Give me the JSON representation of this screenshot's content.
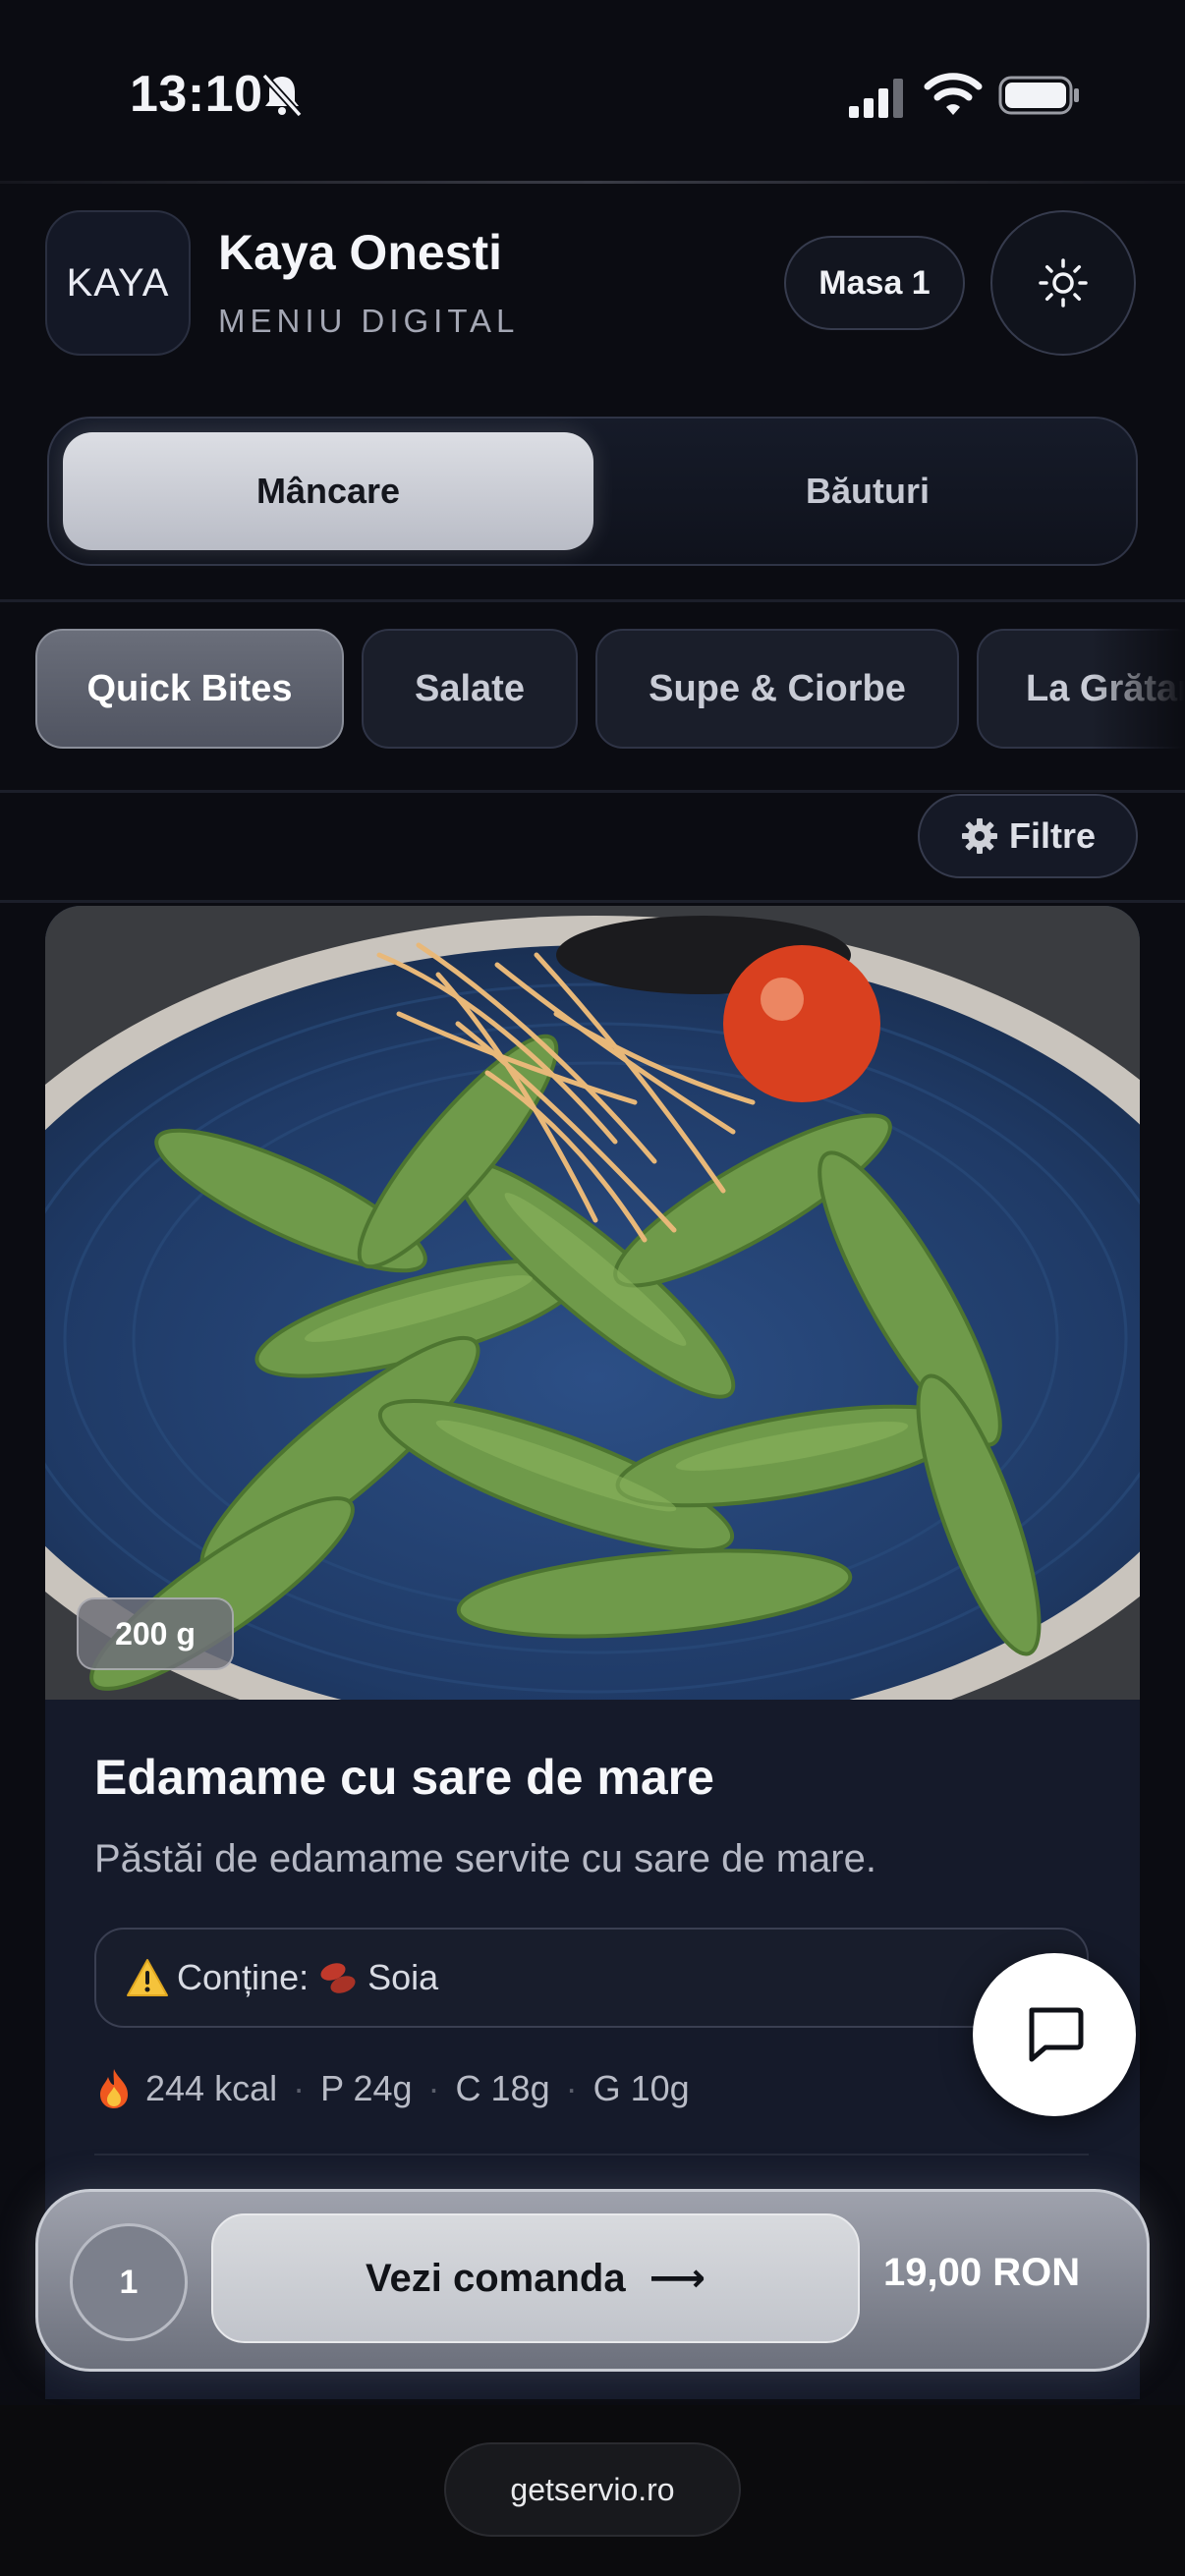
{
  "status_bar": {
    "time": "13:10"
  },
  "header": {
    "logo_text": "KAYA",
    "title": "Kaya Onesti",
    "subtitle": "MENIU DIGITAL",
    "table_label": "Masa 1"
  },
  "segments": {
    "active": "Mâncare",
    "inactive": "Băuturi"
  },
  "categories": [
    {
      "label": "Quick Bites",
      "active": true
    },
    {
      "label": "Salate",
      "active": false
    },
    {
      "label": "Supe & Ciorbe",
      "active": false
    },
    {
      "label": "La Grătar",
      "active": false
    }
  ],
  "filter_label": "Filtre",
  "item": {
    "weight": "200 g",
    "title": "Edamame cu sare de mare",
    "description": "Păstăi de edamame servite cu sare de mare.",
    "allergen_prefix": "Conține:",
    "allergen": "Soia",
    "nutrition": {
      "kcal": "244 kcal",
      "protein": "P 24g",
      "carbs": "C 18g",
      "fat": "G 10g"
    }
  },
  "order_bar": {
    "count": "1",
    "button_label": "Vezi comanda",
    "arrow": "⟶",
    "total": "19,00 RON"
  },
  "footer": {
    "domain": "getservio.ro"
  },
  "colors": {
    "accent": "#c1c4cb",
    "card_bg": "#151a2a",
    "background": "#0b0c12"
  }
}
